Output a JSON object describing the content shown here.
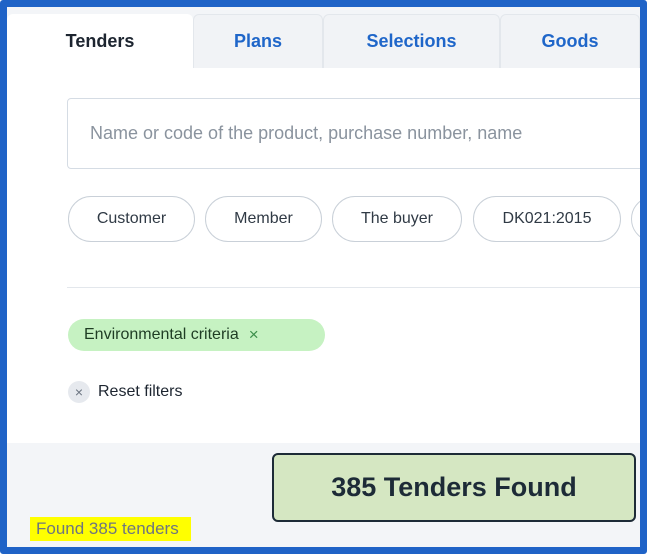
{
  "tabs": [
    {
      "label": "Tenders",
      "active": true
    },
    {
      "label": "Plans",
      "active": false
    },
    {
      "label": "Selections",
      "active": false
    },
    {
      "label": "Goods",
      "active": false
    }
  ],
  "search": {
    "placeholder": "Name or code of the product, purchase number, name"
  },
  "filter_chips": [
    "Customer",
    "Member",
    "The buyer",
    "DK021:2015"
  ],
  "active_filters": {
    "tag_label": "Environmental criteria",
    "tag_remove_icon": "×",
    "reset_icon": "×",
    "reset_label": "Reset filters"
  },
  "results": {
    "callout": "385 Tenders Found",
    "found_text": "Found 385 tenders"
  },
  "colors": {
    "accent": "#1f66c9",
    "frame_border": "#1f63c7",
    "tag_bg": "#c6f2c2",
    "callout_bg": "#d5e7c2",
    "highlight": "#ffff00"
  }
}
